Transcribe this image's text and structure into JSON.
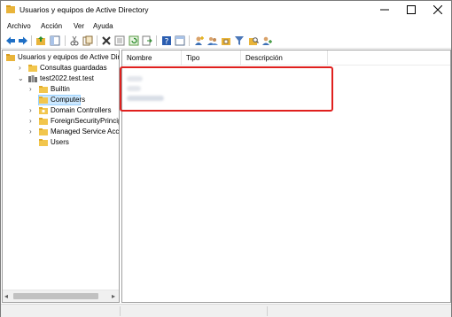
{
  "window": {
    "title": "Usuarios y equipos de Active Directory"
  },
  "menu": [
    "Archivo",
    "Acción",
    "Ver",
    "Ayuda"
  ],
  "toolbar": {
    "icons": [
      "back-arrow-icon",
      "forward-arrow-icon",
      "up-folder-icon",
      "show-hide-tree-icon",
      "cut-icon",
      "copy-icon",
      "delete-icon",
      "properties-icon",
      "refresh-icon",
      "export-list-icon",
      "help-icon",
      "mmc-pane-icon",
      "add-user-icon",
      "add-group-icon",
      "add-ou-icon",
      "filter-icon",
      "find-icon",
      "add-to-group-icon"
    ]
  },
  "tree": {
    "root": "Usuarios y equipos de Active Dir",
    "items": [
      {
        "label": "Consultas guardadas",
        "level": 1,
        "expander": "collapsed",
        "icon": "saved-queries-folder-icon"
      },
      {
        "label": "test2022.test.test",
        "level": 1,
        "expander": "expanded",
        "icon": "domain-icon"
      },
      {
        "label": "Builtin",
        "level": 2,
        "expander": "collapsed",
        "icon": "folder-icon"
      },
      {
        "label": "Computers",
        "level": 2,
        "expander": "none",
        "icon": "folder-icon",
        "selected": true
      },
      {
        "label": "Domain Controllers",
        "level": 2,
        "expander": "collapsed",
        "icon": "ou-folder-icon"
      },
      {
        "label": "ForeignSecurityPrincipals",
        "level": 2,
        "expander": "collapsed",
        "icon": "folder-icon"
      },
      {
        "label": "Managed Service Accour",
        "level": 2,
        "expander": "collapsed",
        "icon": "folder-icon"
      },
      {
        "label": "Users",
        "level": 2,
        "expander": "none",
        "icon": "folder-icon"
      }
    ]
  },
  "list": {
    "columns": [
      "Nombre",
      "Tipo",
      "Descripción"
    ]
  },
  "colors": {
    "selection": "#cce8ff",
    "annotation_box": "#e0201e",
    "folder": "#f2c64d"
  }
}
